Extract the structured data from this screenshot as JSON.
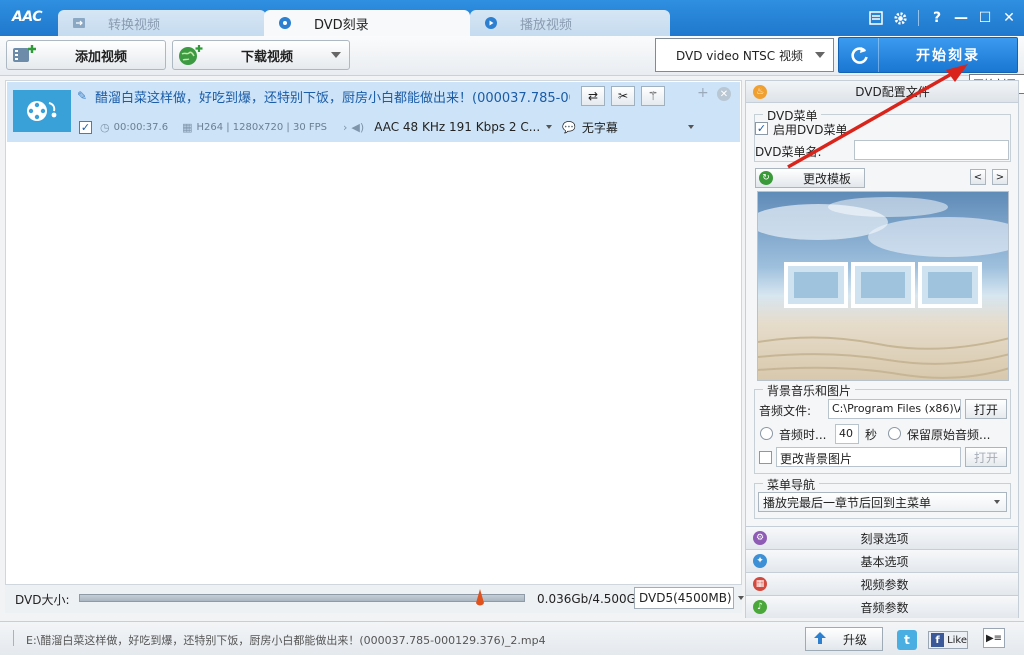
{
  "app": {
    "logo": "AAC"
  },
  "tabs": [
    {
      "label": "转换视频",
      "active": false
    },
    {
      "label": "DVD刻录",
      "active": true
    },
    {
      "label": "播放视频",
      "active": false
    }
  ],
  "window_controls": {
    "help": "?",
    "minimize": "—",
    "maximize": "☐",
    "close": "✕"
  },
  "toolbar": {
    "add_video": "添加视频",
    "download_video": "下载视频",
    "format": "DVD video NTSC 视频",
    "start_burn": "开始刻录",
    "tooltip": "开始刻录"
  },
  "file_list": [
    {
      "title": "醋溜白菜这样做，好吃到爆，还特别下饭，厨房小白都能做出来！(000037.785-000...",
      "duration": "00:00:37.6",
      "video_info": "H264 | 1280x720 | 30 FPS",
      "audio_info": "AAC 48 KHz 191 Kbps 2 C...",
      "subtitle": "无字幕",
      "checked": true
    }
  ],
  "size_bar": {
    "label": "DVD大小:",
    "value": "0.036Gb/4.500Gb",
    "marker_fraction": 0.905,
    "disc": "DVD5(4500MB)"
  },
  "right_panel": {
    "header": "DVD配置文件",
    "dvd_menu": {
      "group_title": "DVD菜单",
      "enable_label": "启用DVD菜单",
      "enable_checked": true,
      "name_label": "DVD菜单名:",
      "name_value": ""
    },
    "template_button": "更改模板",
    "bg": {
      "group_title": "背景音乐和图片",
      "audio_label": "音频文件:",
      "audio_path": "C:\\Program Files (x86)\\A",
      "open_label": "打开",
      "audio_time_label": "音频时...",
      "audio_time_value": "40",
      "seconds_label": "秒",
      "keep_original_label": "保留原始音频...",
      "change_bg_label": "更改背景图片",
      "open_disabled_label": "打开"
    },
    "nav": {
      "group_title": "菜单导航",
      "selected": "播放完最后一章节后回到主菜单"
    },
    "accordion": [
      {
        "label": "刻录选项",
        "icon": "gear-icon",
        "color": "#8e5cb5"
      },
      {
        "label": "基本选项",
        "icon": "wrench-icon",
        "color": "#3d8fd6"
      },
      {
        "label": "视频参数",
        "icon": "film-icon",
        "color": "#d4493d"
      },
      {
        "label": "音频参数",
        "icon": "speaker-icon",
        "color": "#4aa83a"
      }
    ]
  },
  "status": {
    "file_path": "E:\\醋溜白菜这样做，好吃到爆，还特别下饭，厨房小白都能做出来！(000037.785-000129.376)_2.mp4",
    "upgrade": "升级",
    "like": "Like"
  }
}
